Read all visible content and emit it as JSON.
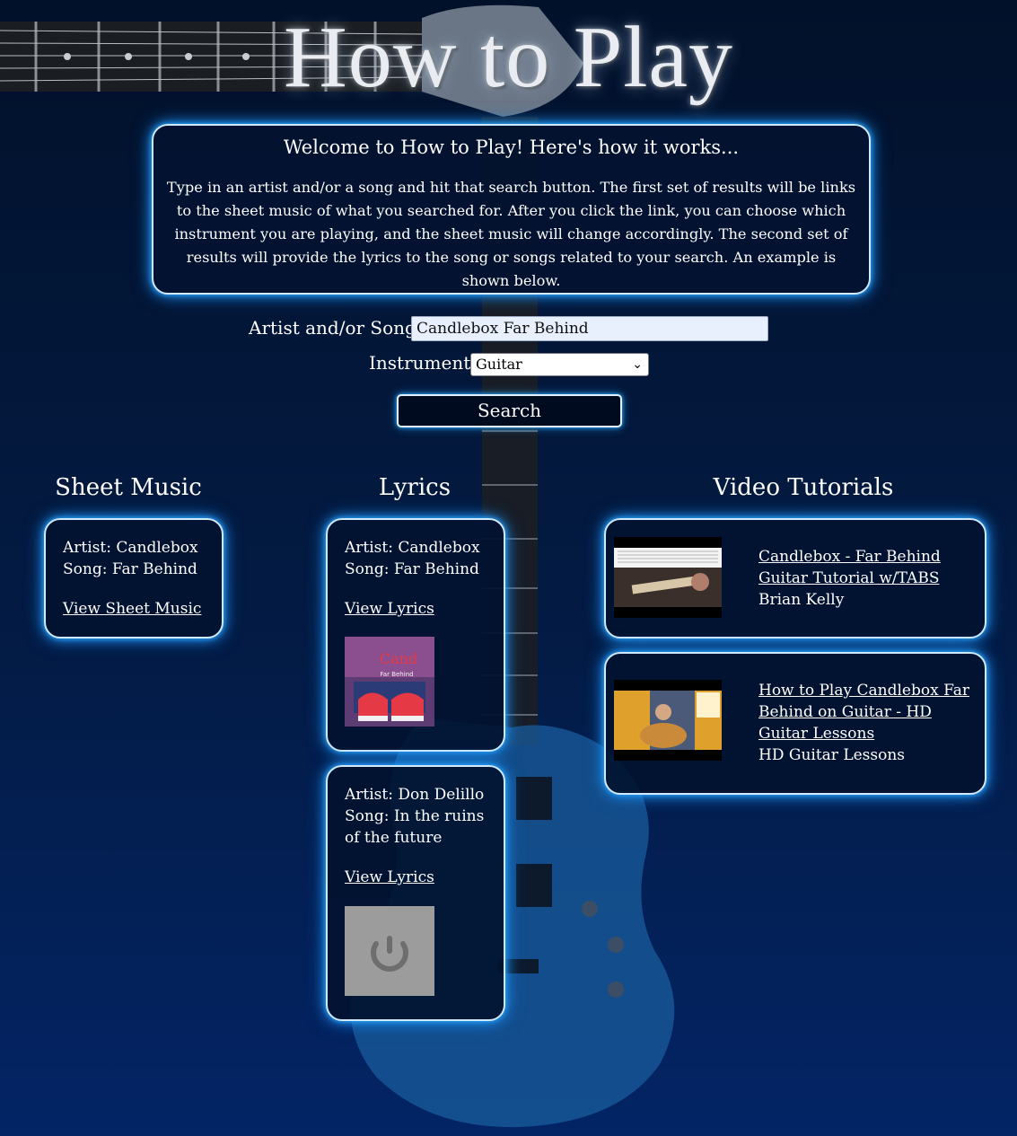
{
  "page": {
    "title": "How to Play"
  },
  "welcome": {
    "heading": "Welcome to How to Play! Here's how it works...",
    "body": "Type in an artist and/or a song and hit that search button. The first set of results will be links to the sheet music of what you searched for. After you click the link, you can choose which instrument you are playing, and the sheet music will change accordingly. The second set of results will provide the lyrics to the song or songs related to your search. An example is shown below."
  },
  "form": {
    "artist_song_label": "Artist and/or Song:",
    "artist_song_value": "Candlebox Far Behind",
    "instrument_label": "Instrument:",
    "instrument_value": "Guitar",
    "search_label": "Search"
  },
  "columns": {
    "sheet_music": "Sheet Music",
    "lyrics": "Lyrics",
    "video_tutorials": "Video Tutorials"
  },
  "sheet_results": [
    {
      "artist": "Artist: Candlebox",
      "song": "Song: Far Behind",
      "link": "View Sheet Music"
    }
  ],
  "lyrics_results": [
    {
      "artist": "Artist: Candlebox",
      "song": "Song: Far Behind",
      "link": "View Lyrics",
      "image": "album-cover-red-shoes"
    },
    {
      "artist": "Artist: Don Delillo",
      "song": "Song: In the ruins of the future",
      "link": "View Lyrics",
      "image": "placeholder-loading-image"
    }
  ],
  "video_results": [
    {
      "title": "Candlebox - Far Behind Guitar Tutorial w/TABS",
      "channel": "Brian Kelly",
      "thumb": "guitar-tabs-video-thumbnail"
    },
    {
      "title": "How to Play Candlebox Far Behind on Guitar - HD Guitar Lessons",
      "channel": "HD Guitar Lessons",
      "thumb": "acoustic-guitar-video-thumbnail"
    }
  ],
  "colors": {
    "glow": "#1d8df0",
    "box_bg": "#021230",
    "background_top": "#02112a",
    "background_bottom": "#032465"
  }
}
